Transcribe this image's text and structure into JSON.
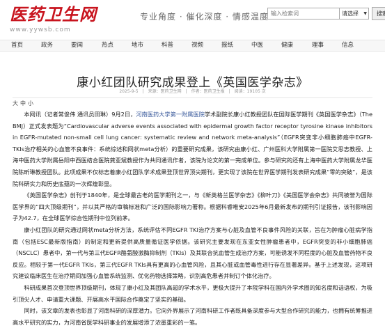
{
  "site": {
    "logo_title": "医药卫生网",
    "logo_url": "www.yywsb.com",
    "slogan": "专业角度 · 催化深度 · 情感温度"
  },
  "search": {
    "placeholder": "输入检索词",
    "select_value": "请选择",
    "button_label": "搜索"
  },
  "nav": [
    "首页",
    "政务",
    "要闻",
    "热点",
    "地市",
    "科普",
    "视频",
    "报纸",
    "中医",
    "健康",
    "理事",
    "信息"
  ],
  "article": {
    "title": "康小红团队研究成果登上《英国医学杂志》",
    "date": "2025-9-5",
    "source": "来源：医药卫生网",
    "author": "作者：医药卫生报",
    "views": "阅读：19105 次"
  },
  "font_controls": {
    "large": "大",
    "medium": "中",
    "small": "小"
  },
  "paragraphs": [
    {
      "before": "本网讯（记者常俊伟 通讯员田琳）9月2日，",
      "link": "河南医药大学第一附属医院",
      "after": "学术副院长康小红教授团队在国际医学期刊《英国医学杂志》（The BMJ）正式发表题为“Cardiovascular adverse events associated with epidermal growth factor receptor tyrosine kinase inhibitors in EGFR-mutated non-small cell lung cancer: systematic review and network meta-analysis”（EGFR突变非小细胞肺癌中EGFR-TKIs治疗相关的心血管不良事件：系统综述和网状meta分析）的重要研究成果，该研究由康小红、广州医科大学附属第一医院艾思志教授、上海中医药大学附属岳阳中西医结合医院龚亚斌教授作为共同通讯作者，该院为论文的第一完成单位。参与研究的还有上海中医药大学附属龙华医院陈昕琳教授团队。此项成果不仅标志着康小红团队学术成果登顶世界顶尖期刊，更实现了该院在世界医学期刊发表研究成果“零的突破”，是该院科研实力和历史底蕴的一次辉煌彰显。"
    },
    {
      "text": "《英国医学杂志》创刊于1840年，是全球最古老的医学期刊之一，与《新英格兰医学杂志》《柳叶刀》《美国医学会杂志》共同被誉为国际医学界的“四大顶级期刊”，并以其严格的审稿标准和广泛的国际影响力著称。根据科睿唯安2025年6月最新发布的期刊引证报告，该刊影响因子为42.7，在全球医学综合性期刊中位列前茅。"
    },
    {
      "text": "康小红团队的研究通过网状meta分析方法，系统评估不同EGFR TKI治疗方案与心脏及血管不良事件风险的关联，旨在为肿瘤心脏病学指南（包括ESC最新版指南）的制定和更新提供高质量循证医学依据。该研究主要发现在东亚女性肿瘤患者中，EGFR突变的非小细胞肺癌（NSCLC）患者中，第一代与第三代EGFR酪氨酸激酶抑制剂（TKIs）及其联合抗血管生成治疗方案，可能诱发不同程度的心脏及血管药物不良反应。相较于第一代EGFR TKIs，第三代EGFR TKIs具有更高的心血管风险，且其心脏或血管毒性进行存在显著差异。基于上述发现，这项研究建议临床医生在治疗期间加强心血管系统监测、优化药物选择策略，识别高危患者并制订个体化治疗。"
    },
    {
      "text": "科研成果首次登顶世界顶级期刊，体现了康小红及其团队高超的学术水平，更极大提升了本院学科在国内外学术圈的知名度和话语权，为吸引顶尖人才、申请重大课题、开展高水平国际合作奠定了坚实的基础。"
    },
    {
      "text": "同时，该文章的发表也彰显了河南科研的深厚潜力。它向外界展示了河南科研工作者既具备深度参与大型合作研究的能力，也拥有统筹推进高水平研究的实力，为河南省医学科研事业的发展增添了浓墨重彩的一笔。"
    }
  ]
}
